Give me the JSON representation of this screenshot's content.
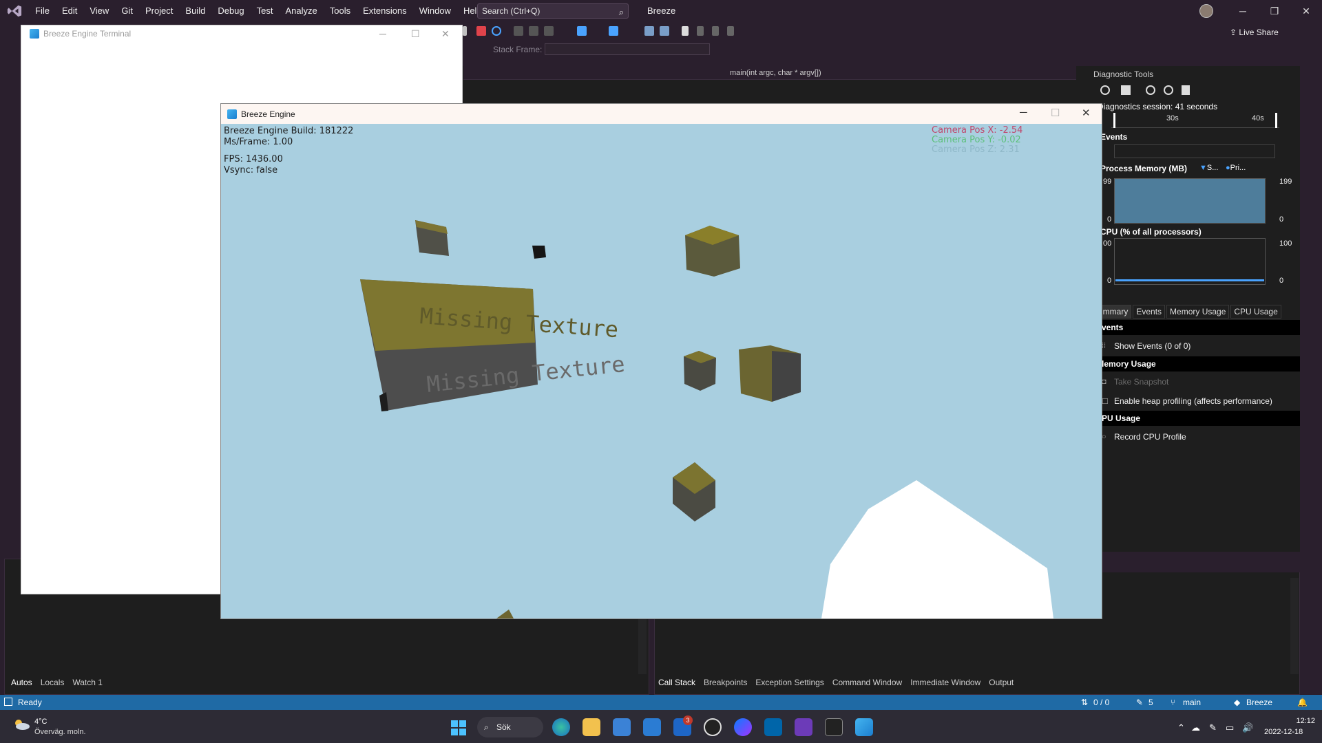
{
  "vs": {
    "menu": [
      "File",
      "Edit",
      "View",
      "Git",
      "Project",
      "Build",
      "Debug",
      "Test",
      "Analyze",
      "Tools",
      "Extensions",
      "Window",
      "Help"
    ],
    "search_placeholder": "Search (Ctrl+Q)",
    "solution_name": "Breeze",
    "live_share": "Live Share",
    "stack_frame_label": "Stack Frame:",
    "function_dropdown": "main(int argc, char * argv[])",
    "window_controls": {
      "minimize": "─",
      "restore": "❐",
      "close": "✕"
    }
  },
  "terminal": {
    "title": "Breeze Engine Terminal",
    "controls": {
      "minimize": "─",
      "maximize": "☐",
      "close": "✕"
    }
  },
  "engine": {
    "title": "Breeze Engine",
    "controls": {
      "minimize": "─",
      "maximize": "☐",
      "close": "✕"
    },
    "hud": {
      "build": "Breeze Engine Build: 181222",
      "ms_frame": "Ms/Frame: 1.00",
      "fps": "FPS: 1436.00",
      "vsync": "Vsync: false",
      "cam_x": "Camera Pos X: -2.54",
      "cam_y": "Camera Pos Y: -0.02",
      "cam_z": "Camera Pos Z: 2.31"
    },
    "missing_texture_label": "Missing Texture",
    "colors": {
      "sky": "#a9cfe0",
      "cam_x": "#c0456a",
      "cam_y": "#5cc07a",
      "cam_z": "#8fb8c8"
    }
  },
  "diagnostic": {
    "title": "Diagnostic Tools",
    "session": "Diagnostics session: 41 seconds",
    "timeline_labels": [
      "30s",
      "40s"
    ],
    "events_header": "Events",
    "memory_header": "Process Memory (MB)",
    "memory_legend": [
      "S...",
      "Pri..."
    ],
    "memory_axis": {
      "top_left": "99",
      "top_right": "199",
      "bottom_left": "0",
      "bottom_right": "0"
    },
    "cpu_header": "CPU (% of all processors)",
    "cpu_axis": {
      "top_left": "00",
      "top_right": "100",
      "bottom_left": "0",
      "bottom_right": "0"
    },
    "tabs": [
      "ummary",
      "Events",
      "Memory Usage",
      "CPU Usage"
    ],
    "sections": {
      "events": "vents",
      "show_events": "Show Events (0 of 0)",
      "memory": "lemory Usage",
      "take_snapshot": "Take Snapshot",
      "heap_profiling": "Enable heap profiling (affects performance)",
      "cpu": "PU Usage",
      "record_cpu": "Record CPU Profile"
    }
  },
  "bottom_left_tabs": [
    "Autos",
    "Locals",
    "Watch 1"
  ],
  "bottom_right_tabs": [
    "Call Stack",
    "Breakpoints",
    "Exception Settings",
    "Command Window",
    "Immediate Window",
    "Output"
  ],
  "status": {
    "ready": "Ready",
    "changes": "0 / 0",
    "edits": "5",
    "branch": "main",
    "repo": "Breeze"
  },
  "taskbar": {
    "temp": "4°C",
    "weather": "Överväg. moln.",
    "search_label": "Sök",
    "time": "12:12",
    "date": "2022-12-18",
    "badge": "3"
  }
}
